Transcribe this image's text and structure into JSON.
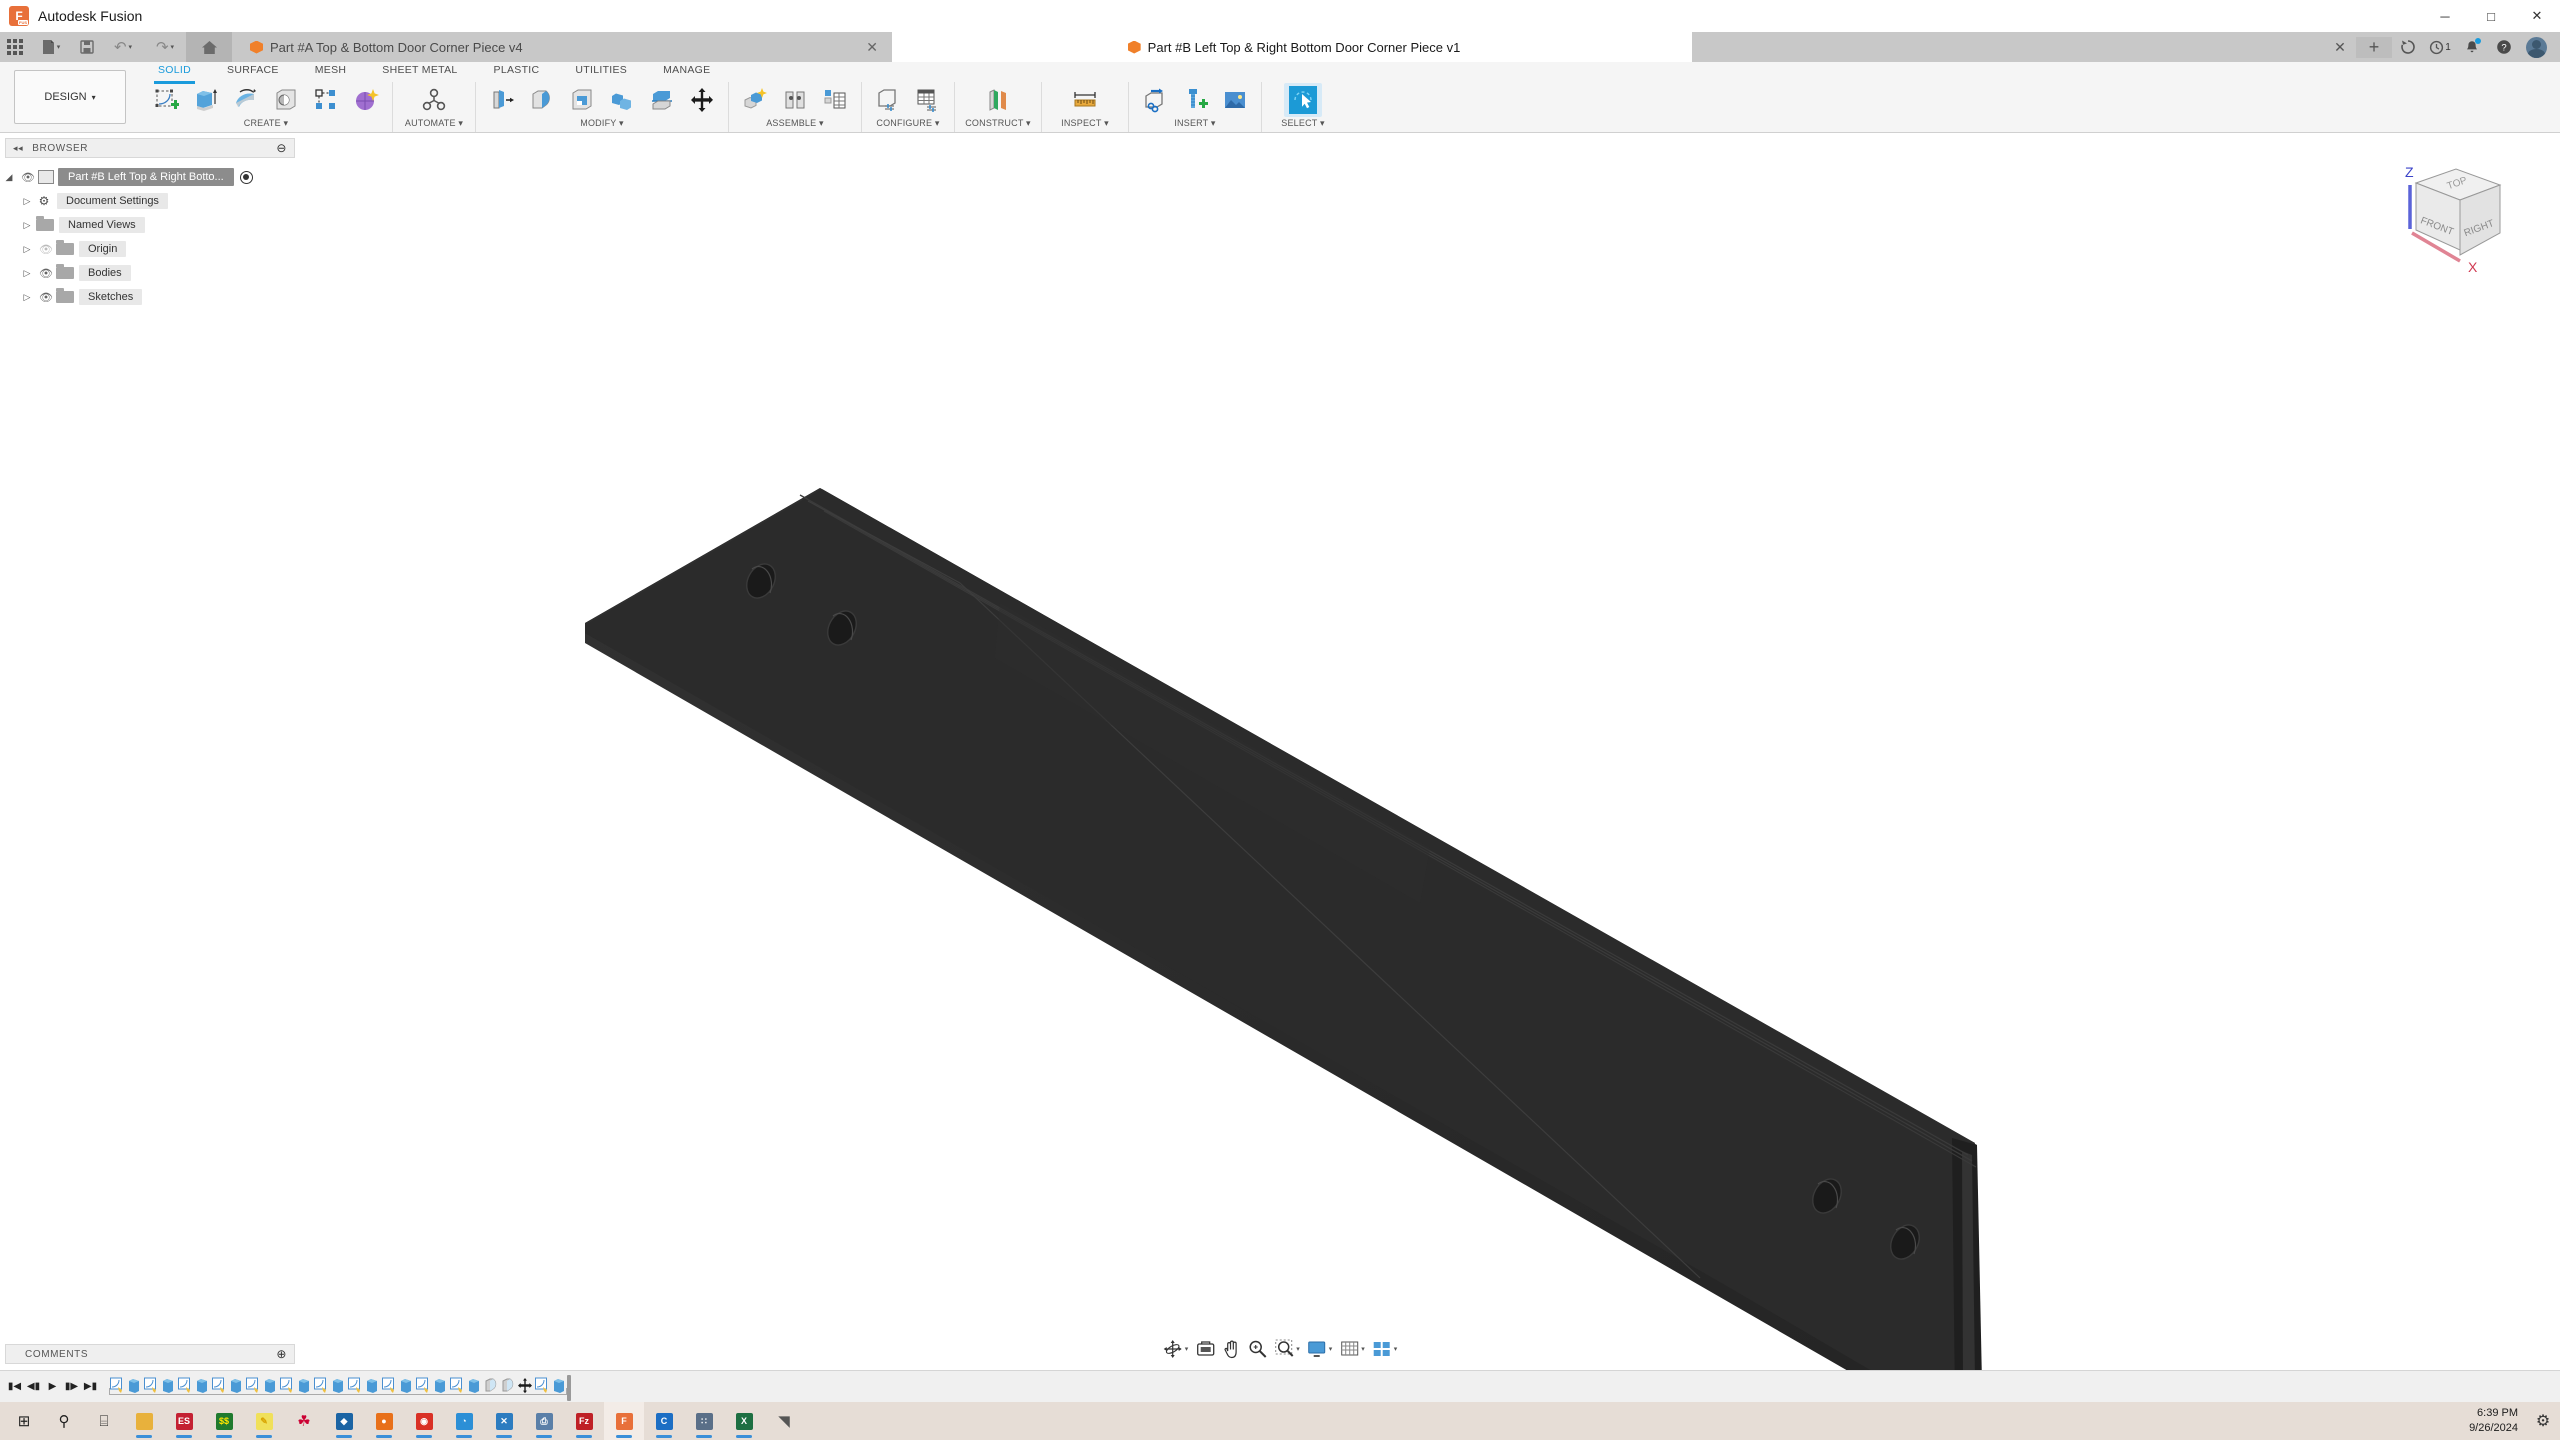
{
  "window": {
    "app_title": "Autodesk Fusion",
    "logo_text": "F",
    "logo_sub": "FUS",
    "minimize": "─",
    "maximize": "□",
    "close": "✕"
  },
  "quickbar": {
    "app_grid": "app-grid",
    "new_doc": "new-document",
    "save": "save",
    "undo": "↶",
    "redo": "↷",
    "home": "home",
    "caret": "▾"
  },
  "tabs": [
    {
      "title": "Part #A Top & Bottom Door Corner Piece v4",
      "active": false,
      "close": "✕"
    },
    {
      "title": "Part #B Left Top & Right Bottom Door Corner Piece v1",
      "active": true,
      "close": "✕"
    }
  ],
  "tab_add": "+",
  "account_bar": {
    "sync_icon": "refresh-icon",
    "job_status_icon": "clock-icon",
    "job_count": "1",
    "notification_icon": "bell-icon",
    "help_icon": "help-icon",
    "avatar": "user-avatar"
  },
  "ribbon": {
    "workspace_label": "DESIGN",
    "workspace_caret": "▾",
    "tabs": [
      {
        "label": "SOLID",
        "active": true
      },
      {
        "label": "SURFACE",
        "active": false
      },
      {
        "label": "MESH",
        "active": false
      },
      {
        "label": "SHEET METAL",
        "active": false
      },
      {
        "label": "PLASTIC",
        "active": false
      },
      {
        "label": "UTILITIES",
        "active": false
      },
      {
        "label": "MANAGE",
        "active": false
      }
    ],
    "panels": [
      {
        "label": "CREATE ▾",
        "tools": [
          "create-sketch-icon",
          "extrude-icon",
          "revolve-icon",
          "hole-icon",
          "rectangular-pattern-icon",
          "create-form-icon"
        ]
      },
      {
        "label": "AUTOMATE ▾",
        "tools": [
          "automate-icon"
        ]
      },
      {
        "label": "MODIFY ▾",
        "tools": [
          "press-pull-icon",
          "fillet-icon",
          "shell-icon",
          "combine-icon",
          "split-body-icon",
          "move-copy-icon"
        ]
      },
      {
        "label": "ASSEMBLE ▾",
        "tools": [
          "new-component-icon",
          "joint-icon",
          "assemble-table-icon"
        ]
      },
      {
        "label": "CONFIGURE ▾",
        "tools": [
          "configure-part-icon",
          "configure-table-icon"
        ]
      },
      {
        "label": "CONSTRUCT ▾",
        "tools": [
          "offset-plane-icon"
        ]
      },
      {
        "label": "INSPECT ▾",
        "tools": [
          "measure-icon"
        ]
      },
      {
        "label": "INSERT ▾",
        "tools": [
          "insert-derive-icon",
          "insert-mcmaster-icon",
          "insert-image-icon"
        ]
      },
      {
        "label": "SELECT ▾",
        "tools": [
          "select-icon"
        ]
      }
    ]
  },
  "browser": {
    "header": "BROWSER",
    "collapse_icon": "◂◂",
    "options_icon": "⊖",
    "items": [
      {
        "label": "Part #B Left Top & Right Botto...",
        "icon": "component-icon",
        "eye": "visible",
        "twist": "◢",
        "root": true,
        "radio": true
      },
      {
        "label": "Document Settings",
        "icon": "gear-icon",
        "eye": "none",
        "twist": "▷",
        "root": false,
        "radio": false
      },
      {
        "label": "Named Views",
        "icon": "folder-icon",
        "eye": "none",
        "twist": "▷",
        "root": false,
        "radio": false
      },
      {
        "label": "Origin",
        "icon": "folder-icon",
        "eye": "hidden",
        "twist": "▷",
        "root": false,
        "radio": false
      },
      {
        "label": "Bodies",
        "icon": "folder-icon",
        "eye": "visible",
        "twist": "▷",
        "root": false,
        "radio": false
      },
      {
        "label": "Sketches",
        "icon": "folder-icon",
        "eye": "visible",
        "twist": "▷",
        "root": false,
        "radio": false
      }
    ]
  },
  "comments": {
    "header": "COMMENTS",
    "add_icon": "⊕"
  },
  "viewcube": {
    "top_face": "TOP",
    "front_face": "FRONT",
    "right_face": "RIGHT",
    "axis_z": "Z",
    "axis_x": "X"
  },
  "navbar": {
    "buttons": [
      {
        "name": "orbit-icon",
        "caret": true
      },
      {
        "name": "look-at-icon",
        "caret": false
      },
      {
        "name": "pan-icon",
        "caret": false
      },
      {
        "name": "zoom-icon",
        "caret": false
      },
      {
        "name": "fit-icon",
        "caret": true
      },
      {
        "name": "display-settings-icon",
        "caret": true
      },
      {
        "name": "grid-snaps-icon",
        "caret": true
      },
      {
        "name": "viewports-icon",
        "caret": true
      }
    ]
  },
  "timeline": {
    "playback": [
      "▮◀",
      "◀▮",
      "▶",
      "▮▶",
      "▶▮"
    ],
    "features": [
      "sketch",
      "extrude",
      "sketch",
      "extrude",
      "sketch",
      "extrude",
      "sketch",
      "extrude",
      "sketch",
      "extrude",
      "sketch",
      "extrude",
      "sketch",
      "extrude",
      "sketch",
      "extrude",
      "sketch",
      "extrude",
      "sketch",
      "extrude",
      "sketch",
      "extrude",
      "fillet",
      "fillet",
      "move",
      "sketch",
      "extrude"
    ]
  },
  "model": {
    "name": "door-corner-piece-3d-body",
    "color": "#2e2e2e"
  },
  "taskbar": {
    "items": [
      {
        "name": "start-button",
        "glyph": "⊞",
        "color": "#1f1f1f",
        "bg": "none",
        "running": false
      },
      {
        "name": "search-icon",
        "glyph": "⚲",
        "color": "#1f1f1f",
        "bg": "none",
        "running": false
      },
      {
        "name": "task-view-icon",
        "glyph": "⌸",
        "color": "#1f1f1f",
        "bg": "none",
        "running": false
      },
      {
        "name": "file-explorer-icon",
        "glyph": "▬",
        "color": "#e8b13c",
        "bg": "#e8b13c",
        "running": true
      },
      {
        "name": "es-app-icon",
        "glyph": "ES",
        "color": "#fff",
        "bg": "#c42032",
        "running": true
      },
      {
        "name": "ss-app-icon",
        "glyph": "$$",
        "color": "#ffe600",
        "bg": "#1f7a2e",
        "running": true
      },
      {
        "name": "notepad-icon",
        "glyph": "✎",
        "color": "#d8a400",
        "bg": "#f0e05a",
        "running": true
      },
      {
        "name": "paint-icon",
        "glyph": "☘",
        "color": "#c03",
        "bg": "none",
        "running": false
      },
      {
        "name": "onshape-icon",
        "glyph": "◆",
        "color": "#fff",
        "bg": "#1b64a4",
        "running": true
      },
      {
        "name": "firefox-icon",
        "glyph": "●",
        "color": "#fff",
        "bg": "#e8701a",
        "running": true
      },
      {
        "name": "chrome-icon",
        "glyph": "◉",
        "color": "#fff",
        "bg": "#d93025",
        "running": true
      },
      {
        "name": "edge-icon",
        "glyph": "◔",
        "color": "#fff",
        "bg": "#2c8fd6",
        "running": true
      },
      {
        "name": "vscode-icon",
        "glyph": "✕",
        "color": "#fff",
        "bg": "#2c7cc0",
        "running": true
      },
      {
        "name": "printer-app-icon",
        "glyph": "⎙",
        "color": "#fff",
        "bg": "#5a7fa8",
        "running": true
      },
      {
        "name": "filezilla-icon",
        "glyph": "Fz",
        "color": "#fff",
        "bg": "#bf2026",
        "running": true
      },
      {
        "name": "fusion-icon",
        "glyph": "F",
        "color": "#fff",
        "bg": "#e8703a",
        "running": true
      },
      {
        "name": "cura-icon",
        "glyph": "C",
        "color": "#fff",
        "bg": "#1c6ec4",
        "running": true
      },
      {
        "name": "calculator-icon",
        "glyph": "∷",
        "color": "#fff",
        "bg": "#5a6f88",
        "running": true
      },
      {
        "name": "excel-icon",
        "glyph": "X",
        "color": "#fff",
        "bg": "#1d6f42",
        "running": true
      },
      {
        "name": "wolf-app-icon",
        "glyph": "◥",
        "color": "#555",
        "bg": "none",
        "running": false
      }
    ],
    "tray": {
      "settings_icon": "⚙"
    },
    "clock_time": "6:39 PM",
    "clock_date": "9/26/2024"
  }
}
